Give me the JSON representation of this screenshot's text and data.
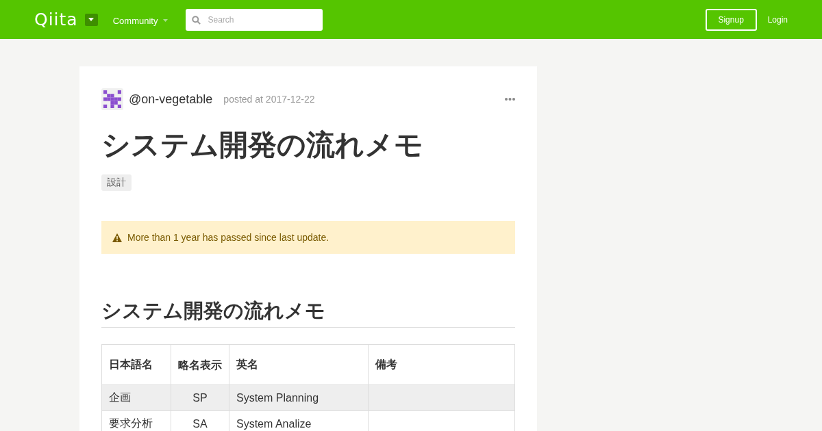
{
  "header": {
    "logo": "Qiita",
    "nav": "Community",
    "search": {
      "placeholder": "Search"
    },
    "signup": "Signup",
    "login": "Login"
  },
  "article": {
    "author": "@on-vegetable",
    "posted": "posted at 2017-12-22",
    "title": "システム開発の流れメモ",
    "tags": [
      "設計"
    ],
    "alert": "More than 1 year has passed since last update.",
    "heading": "システム開発の流れメモ",
    "table": {
      "columns": [
        "日本語名",
        "略名表示",
        "英名",
        "備考"
      ],
      "rows": [
        [
          "企画",
          "SP",
          "System Planning",
          ""
        ],
        [
          "要求分析",
          "SA",
          "System Analize",
          ""
        ]
      ]
    }
  }
}
